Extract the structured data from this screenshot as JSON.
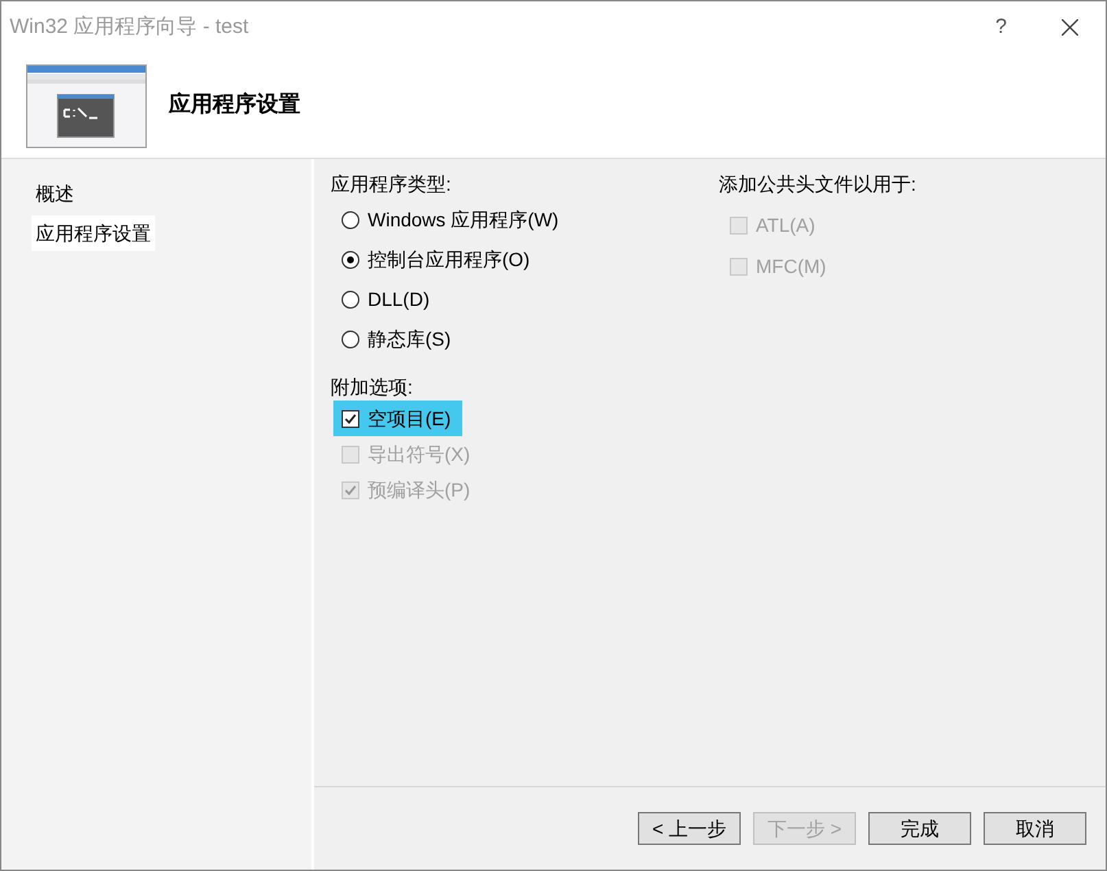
{
  "window": {
    "title": "Win32 应用程序向导 - test",
    "help": "?"
  },
  "header": {
    "title": "应用程序设置"
  },
  "sidebar": {
    "items": [
      {
        "label": "概述",
        "selected": false
      },
      {
        "label": "应用程序设置",
        "selected": true
      }
    ]
  },
  "app_type": {
    "heading": "应用程序类型:",
    "options": [
      {
        "label": "Windows 应用程序(W)",
        "selected": false
      },
      {
        "label": "控制台应用程序(O)",
        "selected": true
      },
      {
        "label": "DLL(D)",
        "selected": false
      },
      {
        "label": "静态库(S)",
        "selected": false
      }
    ]
  },
  "extra_options": {
    "heading": "附加选项:",
    "options": [
      {
        "label": "空项目(E)",
        "checked": true,
        "disabled": false,
        "highlighted": true
      },
      {
        "label": "导出符号(X)",
        "checked": false,
        "disabled": true,
        "highlighted": false
      },
      {
        "label": "预编译头(P)",
        "checked": true,
        "disabled": true,
        "highlighted": false
      }
    ]
  },
  "common_headers": {
    "heading": "添加公共头文件以用于:",
    "options": [
      {
        "label": "ATL(A)",
        "checked": false,
        "disabled": true
      },
      {
        "label": "MFC(M)",
        "checked": false,
        "disabled": true
      }
    ]
  },
  "buttons": [
    {
      "label": "< 上一步",
      "disabled": false
    },
    {
      "label": "下一步 >",
      "disabled": true
    },
    {
      "label": "完成",
      "disabled": false
    },
    {
      "label": "取消",
      "disabled": false
    }
  ]
}
